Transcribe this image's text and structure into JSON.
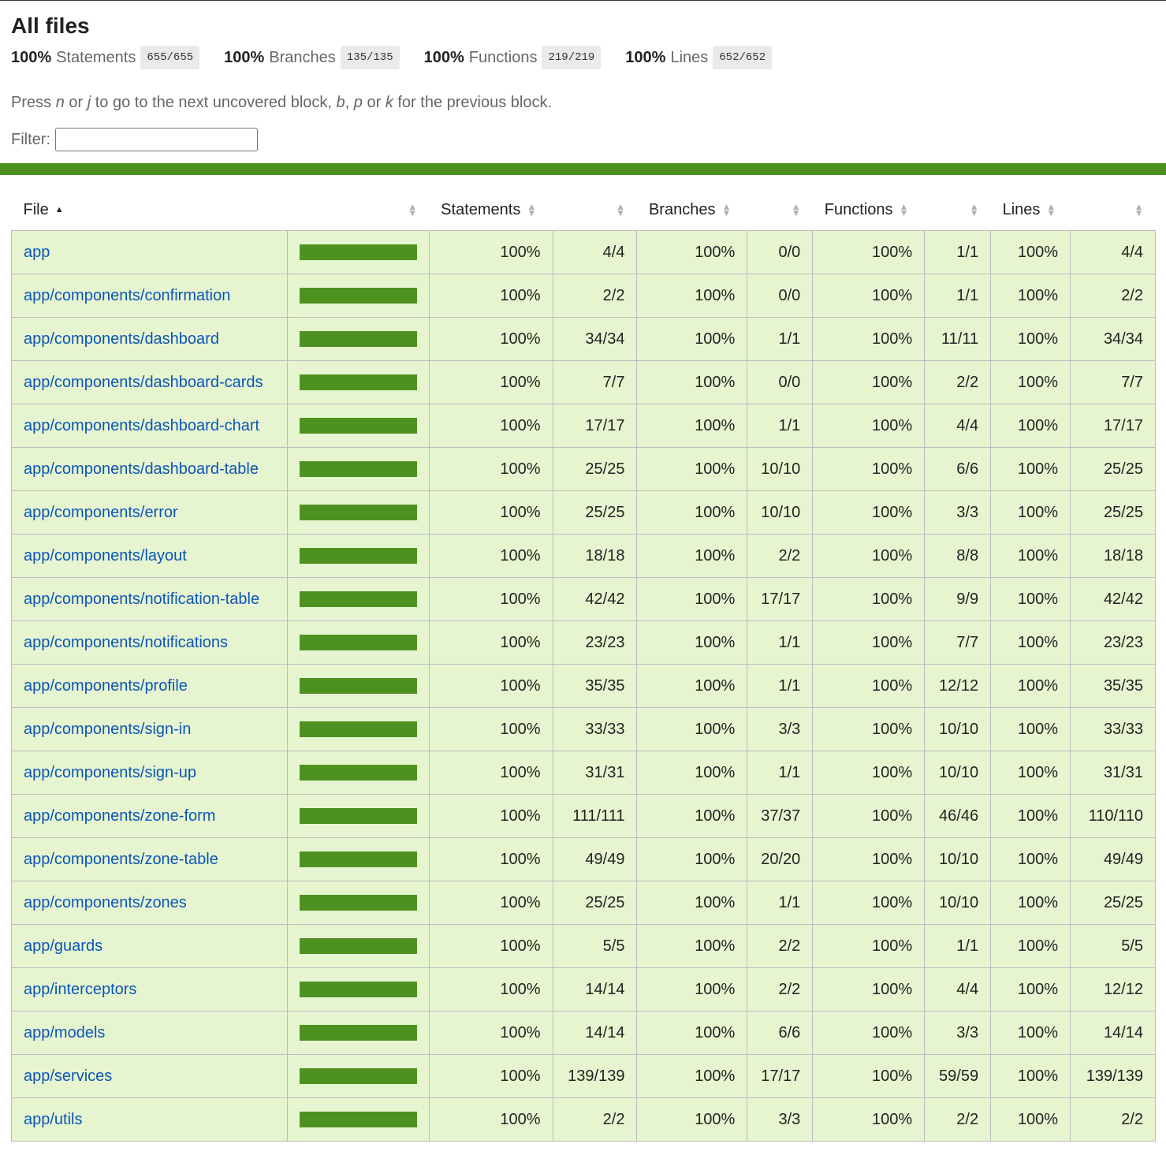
{
  "page": {
    "title": "All files",
    "summary": [
      {
        "pct": "100%",
        "label": "Statements",
        "fraction": "655/655"
      },
      {
        "pct": "100%",
        "label": "Branches",
        "fraction": "135/135"
      },
      {
        "pct": "100%",
        "label": "Functions",
        "fraction": "219/219"
      },
      {
        "pct": "100%",
        "label": "Lines",
        "fraction": "652/652"
      }
    ],
    "hint": {
      "press": "Press",
      "key_n": "n",
      "or1": "or",
      "key_j": "j",
      "middle": "to go to the next uncovered block,",
      "key_b": "b",
      "comma": ",",
      "key_p": "p",
      "or2": "or",
      "key_k": "k",
      "end": "for the previous block."
    },
    "filter": {
      "label": "Filter:",
      "value": ""
    }
  },
  "colors": {
    "status_bar": "#4d9221",
    "row_bg": "#e6f5d0",
    "link": "#0b55b8"
  },
  "table": {
    "headers": {
      "file": "File",
      "statements": "Statements",
      "branches": "Branches",
      "functions": "Functions",
      "lines": "Lines"
    },
    "sort": {
      "column": "File",
      "direction": "ascending"
    },
    "rows": [
      {
        "file": "app",
        "coverage": 1.0,
        "stmt_pct": "100%",
        "stmt": "4/4",
        "br_pct": "100%",
        "br": "0/0",
        "fn_pct": "100%",
        "fn": "1/1",
        "ln_pct": "100%",
        "ln": "4/4"
      },
      {
        "file": "app/components/confirmation",
        "coverage": 1.0,
        "stmt_pct": "100%",
        "stmt": "2/2",
        "br_pct": "100%",
        "br": "0/0",
        "fn_pct": "100%",
        "fn": "1/1",
        "ln_pct": "100%",
        "ln": "2/2"
      },
      {
        "file": "app/components/dashboard",
        "coverage": 1.0,
        "stmt_pct": "100%",
        "stmt": "34/34",
        "br_pct": "100%",
        "br": "1/1",
        "fn_pct": "100%",
        "fn": "11/11",
        "ln_pct": "100%",
        "ln": "34/34"
      },
      {
        "file": "app/components/dashboard-cards",
        "coverage": 1.0,
        "stmt_pct": "100%",
        "stmt": "7/7",
        "br_pct": "100%",
        "br": "0/0",
        "fn_pct": "100%",
        "fn": "2/2",
        "ln_pct": "100%",
        "ln": "7/7"
      },
      {
        "file": "app/components/dashboard-chart",
        "coverage": 1.0,
        "stmt_pct": "100%",
        "stmt": "17/17",
        "br_pct": "100%",
        "br": "1/1",
        "fn_pct": "100%",
        "fn": "4/4",
        "ln_pct": "100%",
        "ln": "17/17"
      },
      {
        "file": "app/components/dashboard-table",
        "coverage": 1.0,
        "stmt_pct": "100%",
        "stmt": "25/25",
        "br_pct": "100%",
        "br": "10/10",
        "fn_pct": "100%",
        "fn": "6/6",
        "ln_pct": "100%",
        "ln": "25/25"
      },
      {
        "file": "app/components/error",
        "coverage": 1.0,
        "stmt_pct": "100%",
        "stmt": "25/25",
        "br_pct": "100%",
        "br": "10/10",
        "fn_pct": "100%",
        "fn": "3/3",
        "ln_pct": "100%",
        "ln": "25/25"
      },
      {
        "file": "app/components/layout",
        "coverage": 1.0,
        "stmt_pct": "100%",
        "stmt": "18/18",
        "br_pct": "100%",
        "br": "2/2",
        "fn_pct": "100%",
        "fn": "8/8",
        "ln_pct": "100%",
        "ln": "18/18"
      },
      {
        "file": "app/components/notification-table",
        "coverage": 1.0,
        "stmt_pct": "100%",
        "stmt": "42/42",
        "br_pct": "100%",
        "br": "17/17",
        "fn_pct": "100%",
        "fn": "9/9",
        "ln_pct": "100%",
        "ln": "42/42"
      },
      {
        "file": "app/components/notifications",
        "coverage": 1.0,
        "stmt_pct": "100%",
        "stmt": "23/23",
        "br_pct": "100%",
        "br": "1/1",
        "fn_pct": "100%",
        "fn": "7/7",
        "ln_pct": "100%",
        "ln": "23/23"
      },
      {
        "file": "app/components/profile",
        "coverage": 1.0,
        "stmt_pct": "100%",
        "stmt": "35/35",
        "br_pct": "100%",
        "br": "1/1",
        "fn_pct": "100%",
        "fn": "12/12",
        "ln_pct": "100%",
        "ln": "35/35"
      },
      {
        "file": "app/components/sign-in",
        "coverage": 1.0,
        "stmt_pct": "100%",
        "stmt": "33/33",
        "br_pct": "100%",
        "br": "3/3",
        "fn_pct": "100%",
        "fn": "10/10",
        "ln_pct": "100%",
        "ln": "33/33"
      },
      {
        "file": "app/components/sign-up",
        "coverage": 1.0,
        "stmt_pct": "100%",
        "stmt": "31/31",
        "br_pct": "100%",
        "br": "1/1",
        "fn_pct": "100%",
        "fn": "10/10",
        "ln_pct": "100%",
        "ln": "31/31"
      },
      {
        "file": "app/components/zone-form",
        "coverage": 1.0,
        "stmt_pct": "100%",
        "stmt": "111/111",
        "br_pct": "100%",
        "br": "37/37",
        "fn_pct": "100%",
        "fn": "46/46",
        "ln_pct": "100%",
        "ln": "110/110"
      },
      {
        "file": "app/components/zone-table",
        "coverage": 1.0,
        "stmt_pct": "100%",
        "stmt": "49/49",
        "br_pct": "100%",
        "br": "20/20",
        "fn_pct": "100%",
        "fn": "10/10",
        "ln_pct": "100%",
        "ln": "49/49"
      },
      {
        "file": "app/components/zones",
        "coverage": 1.0,
        "stmt_pct": "100%",
        "stmt": "25/25",
        "br_pct": "100%",
        "br": "1/1",
        "fn_pct": "100%",
        "fn": "10/10",
        "ln_pct": "100%",
        "ln": "25/25"
      },
      {
        "file": "app/guards",
        "coverage": 1.0,
        "stmt_pct": "100%",
        "stmt": "5/5",
        "br_pct": "100%",
        "br": "2/2",
        "fn_pct": "100%",
        "fn": "1/1",
        "ln_pct": "100%",
        "ln": "5/5"
      },
      {
        "file": "app/interceptors",
        "coverage": 1.0,
        "stmt_pct": "100%",
        "stmt": "14/14",
        "br_pct": "100%",
        "br": "2/2",
        "fn_pct": "100%",
        "fn": "4/4",
        "ln_pct": "100%",
        "ln": "12/12"
      },
      {
        "file": "app/models",
        "coverage": 1.0,
        "stmt_pct": "100%",
        "stmt": "14/14",
        "br_pct": "100%",
        "br": "6/6",
        "fn_pct": "100%",
        "fn": "3/3",
        "ln_pct": "100%",
        "ln": "14/14"
      },
      {
        "file": "app/services",
        "coverage": 1.0,
        "stmt_pct": "100%",
        "stmt": "139/139",
        "br_pct": "100%",
        "br": "17/17",
        "fn_pct": "100%",
        "fn": "59/59",
        "ln_pct": "100%",
        "ln": "139/139"
      },
      {
        "file": "app/utils",
        "coverage": 1.0,
        "stmt_pct": "100%",
        "stmt": "2/2",
        "br_pct": "100%",
        "br": "3/3",
        "fn_pct": "100%",
        "fn": "2/2",
        "ln_pct": "100%",
        "ln": "2/2"
      }
    ]
  }
}
